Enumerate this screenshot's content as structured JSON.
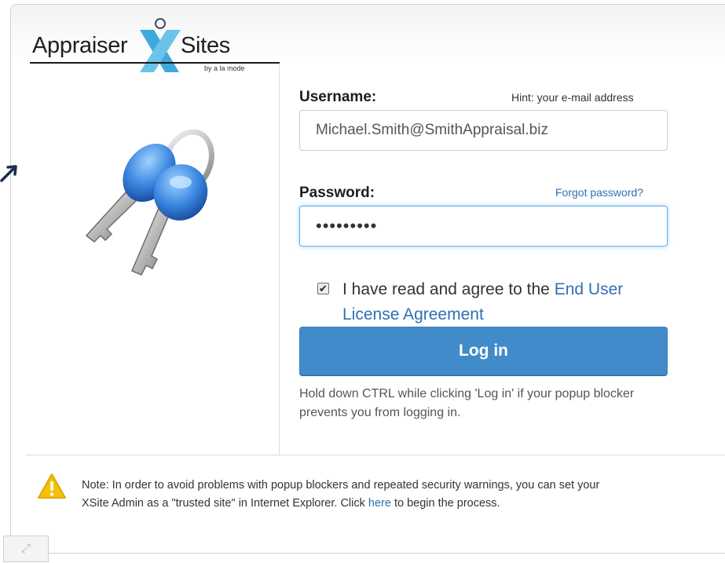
{
  "logo": {
    "word_left": "Appraiser",
    "word_right": "Sites",
    "tagline": "by a la mode"
  },
  "form": {
    "username_label": "Username:",
    "username_hint": "Hint: your e-mail address",
    "username_value": "Michael.Smith@SmithAppraisal.biz",
    "password_label": "Password:",
    "forgot_link": "Forgot password?",
    "password_value": "•••••••••",
    "eula_prefix": "I have read and agree to the ",
    "eula_link": "End User License Agreement",
    "eula_checked": "✔",
    "login_button": "Log in",
    "help_text": "Hold down CTRL while clicking 'Log in' if your popup blocker prevents you from logging in."
  },
  "note": {
    "line1": "Note: In order to avoid problems with popup blockers and repeated security warnings, you can set your",
    "line2_prefix": "XSite Admin as a \"trusted site\" in Internet Explorer. Click ",
    "link": "here",
    "line2_suffix": " to begin the process."
  },
  "icons": {
    "keys": "keys-icon",
    "warning": "warning-icon",
    "expand": "expand-icon"
  },
  "colors": {
    "accent": "#428bca",
    "link": "#2f6fb5",
    "warning": "#f4c20d"
  }
}
